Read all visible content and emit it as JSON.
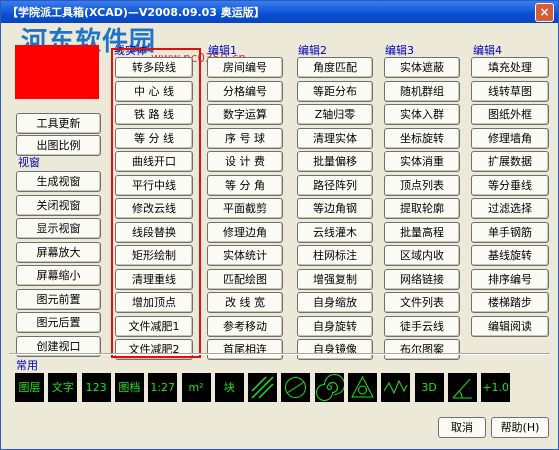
{
  "window": {
    "title": "【学院派工具箱(XCAD)—V2008.09.03 奥运版】",
    "close_glyph": "×"
  },
  "watermark": {
    "text": "河东软件园",
    "url": "www.pc0359.cn"
  },
  "color_swatch": {
    "color": "#ff0000"
  },
  "left_buttons": [
    "工具更新",
    "出图比例"
  ],
  "view_group": {
    "label": "视窗",
    "items": [
      "生成视窗",
      "关闭视窗",
      "显示视窗",
      "屏幕放大",
      "屏幕缩小",
      "图元前置",
      "图元后置",
      "创建视口"
    ]
  },
  "groups": {
    "line_entity": {
      "label": "线实体",
      "items": [
        "转多段线",
        "中 心 线",
        "铁 路 线",
        "等 分 线",
        "曲线开口",
        "平行中线",
        "修改云线",
        "线段替换",
        "矩形绘制",
        "清理重线",
        "增加顶点",
        "文件减肥1",
        "文件减肥2"
      ]
    },
    "edit1": {
      "label": "编辑1",
      "items": [
        "房间编号",
        "分格编号",
        "数字运算",
        "序 号 球",
        "设 计 费",
        "等 分 角",
        "平面截剪",
        "修理边角",
        "实体统计",
        "匹配绘图",
        "改 线 宽",
        "参考移动",
        "首尾相连"
      ]
    },
    "edit2": {
      "label": "编辑2",
      "items": [
        "角度匹配",
        "等距分布",
        "Z轴归零",
        "清理实体",
        "批量偏移",
        "路径阵列",
        "等边角钢",
        "云线灌木",
        "柱网标注",
        "增强复制",
        "自身缩放",
        "自身旋转",
        "自身镜像"
      ]
    },
    "edit3": {
      "label": "编辑3",
      "items": [
        "实体遮蔽",
        "随机群组",
        "实体入群",
        "坐标旋转",
        "实体消重",
        "顶点列表",
        "提取轮廓",
        "批量高程",
        "区域内收",
        "网络链接",
        "文件列表",
        "徒手云线",
        "布尔图案"
      ]
    },
    "edit4": {
      "label": "编辑4",
      "items": [
        "填充处理",
        "线转草图",
        "图纸外框",
        "修理墙角",
        "扩展数据",
        "等分垂线",
        "过滤选择",
        "单手钢筋",
        "基线旋转",
        "排序编号",
        "楼梯踏步",
        "编辑阅读"
      ]
    }
  },
  "common": {
    "label": "常用",
    "icons": [
      {
        "name": "layer-icon",
        "text": "图层"
      },
      {
        "name": "insert-icon",
        "text": "文字"
      },
      {
        "name": "dimension-icon",
        "text": "123"
      },
      {
        "name": "drawing-archive-icon",
        "text": "图档"
      },
      {
        "name": "unit-convert-icon",
        "text": "1:27"
      },
      {
        "name": "area-m2-icon",
        "text": "m²"
      },
      {
        "name": "block-icon",
        "text": "块"
      },
      {
        "name": "hatch-icon",
        "text": ""
      },
      {
        "name": "circle-pattern-icon",
        "text": ""
      },
      {
        "name": "spiral-icon",
        "text": ""
      },
      {
        "name": "triangle-icon",
        "text": ""
      },
      {
        "name": "wave-icon",
        "text": ""
      },
      {
        "name": "three-d-icon",
        "text": "3D"
      },
      {
        "name": "angle-icon",
        "text": ""
      },
      {
        "name": "count-icon",
        "text": "+1.0"
      }
    ]
  },
  "footer": {
    "cancel_label": "取消",
    "help_label": "帮助(H)"
  }
}
